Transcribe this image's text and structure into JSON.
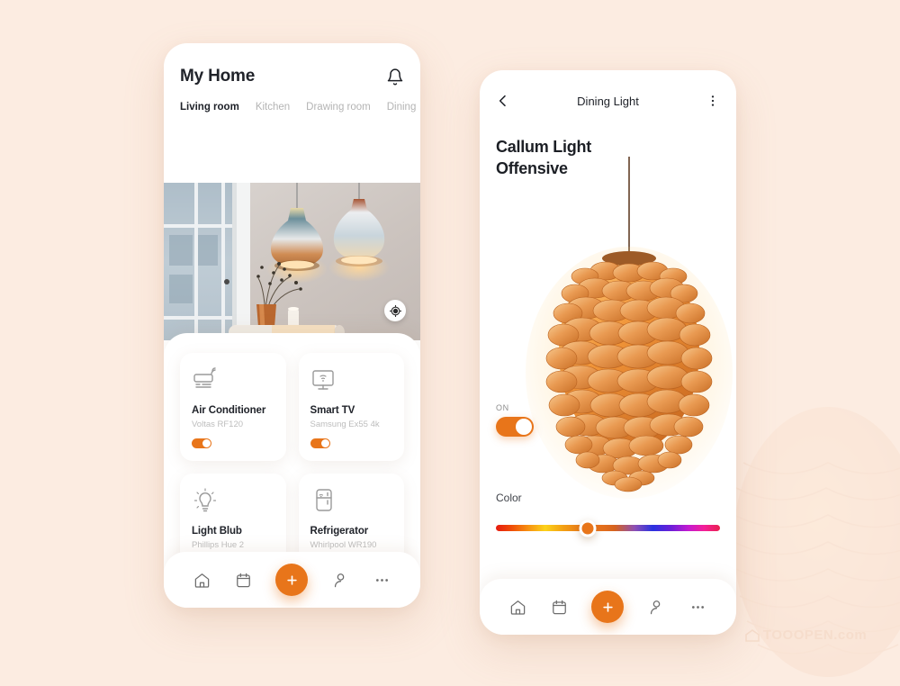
{
  "background": {
    "color": "#fcece1",
    "accent": "#e8751a"
  },
  "watermark": {
    "text": "TOOOPEN.com"
  },
  "left_phone": {
    "header": {
      "title": "My Home",
      "bell_icon": "bell-icon"
    },
    "tabs": [
      {
        "label": "Living room",
        "active": true
      },
      {
        "label": "Kitchen",
        "active": false
      },
      {
        "label": "Drawing room",
        "active": false
      },
      {
        "label": "Dining",
        "active": false
      }
    ],
    "hero": {
      "locate_icon": "locate-target-icon",
      "alt": "living room with two pendant lamps by a window"
    },
    "devices": [
      {
        "name": "Air Conditioner",
        "model": "Voltas RF120",
        "icon": "air-conditioner-icon",
        "on": true
      },
      {
        "name": "Smart TV",
        "model": "Samsung Ex55 4k",
        "icon": "smart-tv-icon",
        "on": true
      },
      {
        "name": "Light Blub",
        "model": "Phillips Hue 2",
        "icon": "light-bulb-icon",
        "on": true
      },
      {
        "name": "Refrigerator",
        "model": "Whirlpool WR190",
        "icon": "refrigerator-icon",
        "on": true
      }
    ],
    "nav": [
      {
        "icon": "home-icon",
        "name": "home"
      },
      {
        "icon": "calendar-icon",
        "name": "calendar"
      },
      {
        "icon": "plus-icon",
        "name": "add"
      },
      {
        "icon": "person-icon",
        "name": "profile"
      },
      {
        "icon": "more-dots-icon",
        "name": "more"
      }
    ]
  },
  "right_phone": {
    "header": {
      "back_icon": "chevron-left-icon",
      "title": "Dining Light",
      "menu_icon": "kebab-menu-icon"
    },
    "product": {
      "title": "Callum Light Offensive",
      "alt": "pine cone pendant lamp glowing warm orange"
    },
    "power": {
      "label": "ON",
      "state": true
    },
    "color": {
      "label": "Color",
      "position_percent": 41
    },
    "nav": [
      {
        "icon": "home-icon",
        "name": "home"
      },
      {
        "icon": "calendar-icon",
        "name": "calendar"
      },
      {
        "icon": "plus-icon",
        "name": "add"
      },
      {
        "icon": "person-icon",
        "name": "profile"
      },
      {
        "icon": "more-dots-icon",
        "name": "more"
      }
    ]
  }
}
